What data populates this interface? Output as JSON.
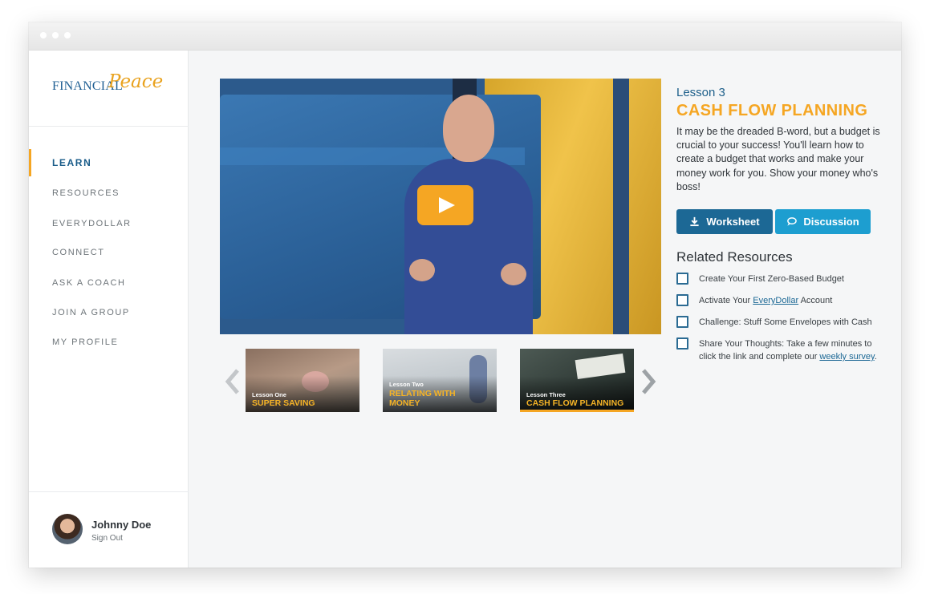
{
  "logo": {
    "financial": "FINANCIAL",
    "peace": "Peace"
  },
  "nav": {
    "items": [
      {
        "label": "LEARN",
        "active": true
      },
      {
        "label": "RESOURCES"
      },
      {
        "label": "EVERYDOLLAR"
      },
      {
        "label": "CONNECT"
      },
      {
        "label": "ASK A COACH"
      },
      {
        "label": "JOIN A GROUP"
      },
      {
        "label": "MY PROFILE"
      }
    ]
  },
  "user": {
    "name": "Johnny Doe",
    "sign_out": "Sign Out"
  },
  "video": {
    "play_icon": "play-icon"
  },
  "lessons": [
    {
      "label": "Lesson One",
      "title_lines": [
        "SUPER SAVING"
      ]
    },
    {
      "label": "Lesson Two",
      "title_lines": [
        "RELATING WITH",
        "MONEY"
      ]
    },
    {
      "label": "Lesson Three",
      "title_lines": [
        "CASH FLOW PLANNING"
      ],
      "active": true
    }
  ],
  "lesson": {
    "number": "Lesson 3",
    "title": "CASH FLOW PLANNING",
    "description": "It may be the dreaded B-word, but a budget is crucial to your success! You'll learn how to create a budget that works and make your money work for you. Show your money who's boss!"
  },
  "buttons": {
    "worksheet": "Worksheet",
    "discussion": "Discussion"
  },
  "related": {
    "title": "Related Resources",
    "items": [
      {
        "text": "Create Your First Zero-Based Budget"
      },
      {
        "before": "Activate Your ",
        "link": "EveryDollar",
        "after": " Account"
      },
      {
        "text": "Challenge: Stuff Some Envelopes with Cash"
      },
      {
        "before": "Share Your Thoughts: Take a few minutes to click the link and complete our ",
        "link": "weekly survey",
        "after": "."
      }
    ]
  },
  "colors": {
    "accent": "#f5a623",
    "primary": "#1c6895",
    "secondary": "#1d9ed0"
  }
}
